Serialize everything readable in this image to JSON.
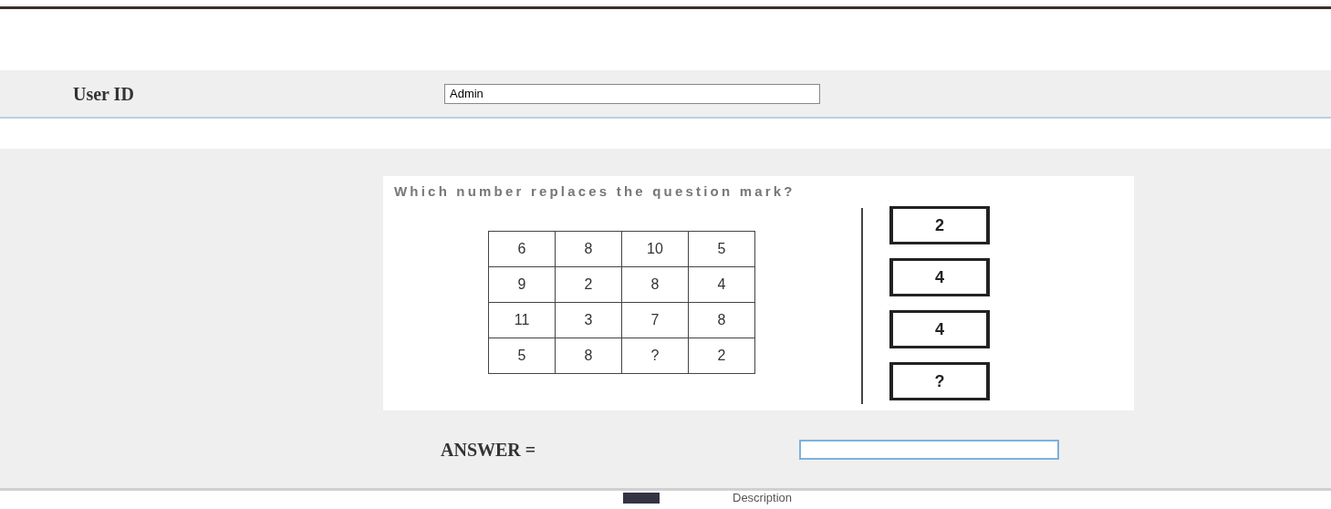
{
  "login": {
    "label": "User ID",
    "value": "Admin"
  },
  "puzzle": {
    "question": "Which number replaces the question mark?",
    "grid": [
      [
        "6",
        "8",
        "10",
        "5"
      ],
      [
        "9",
        "2",
        "8",
        "4"
      ],
      [
        "11",
        "3",
        "7",
        "8"
      ],
      [
        "5",
        "8",
        "?",
        "2"
      ]
    ],
    "options": [
      "2",
      "4",
      "4",
      "?"
    ]
  },
  "answer": {
    "label": "ANSWER ="
  },
  "footer": {
    "text": "Description"
  }
}
